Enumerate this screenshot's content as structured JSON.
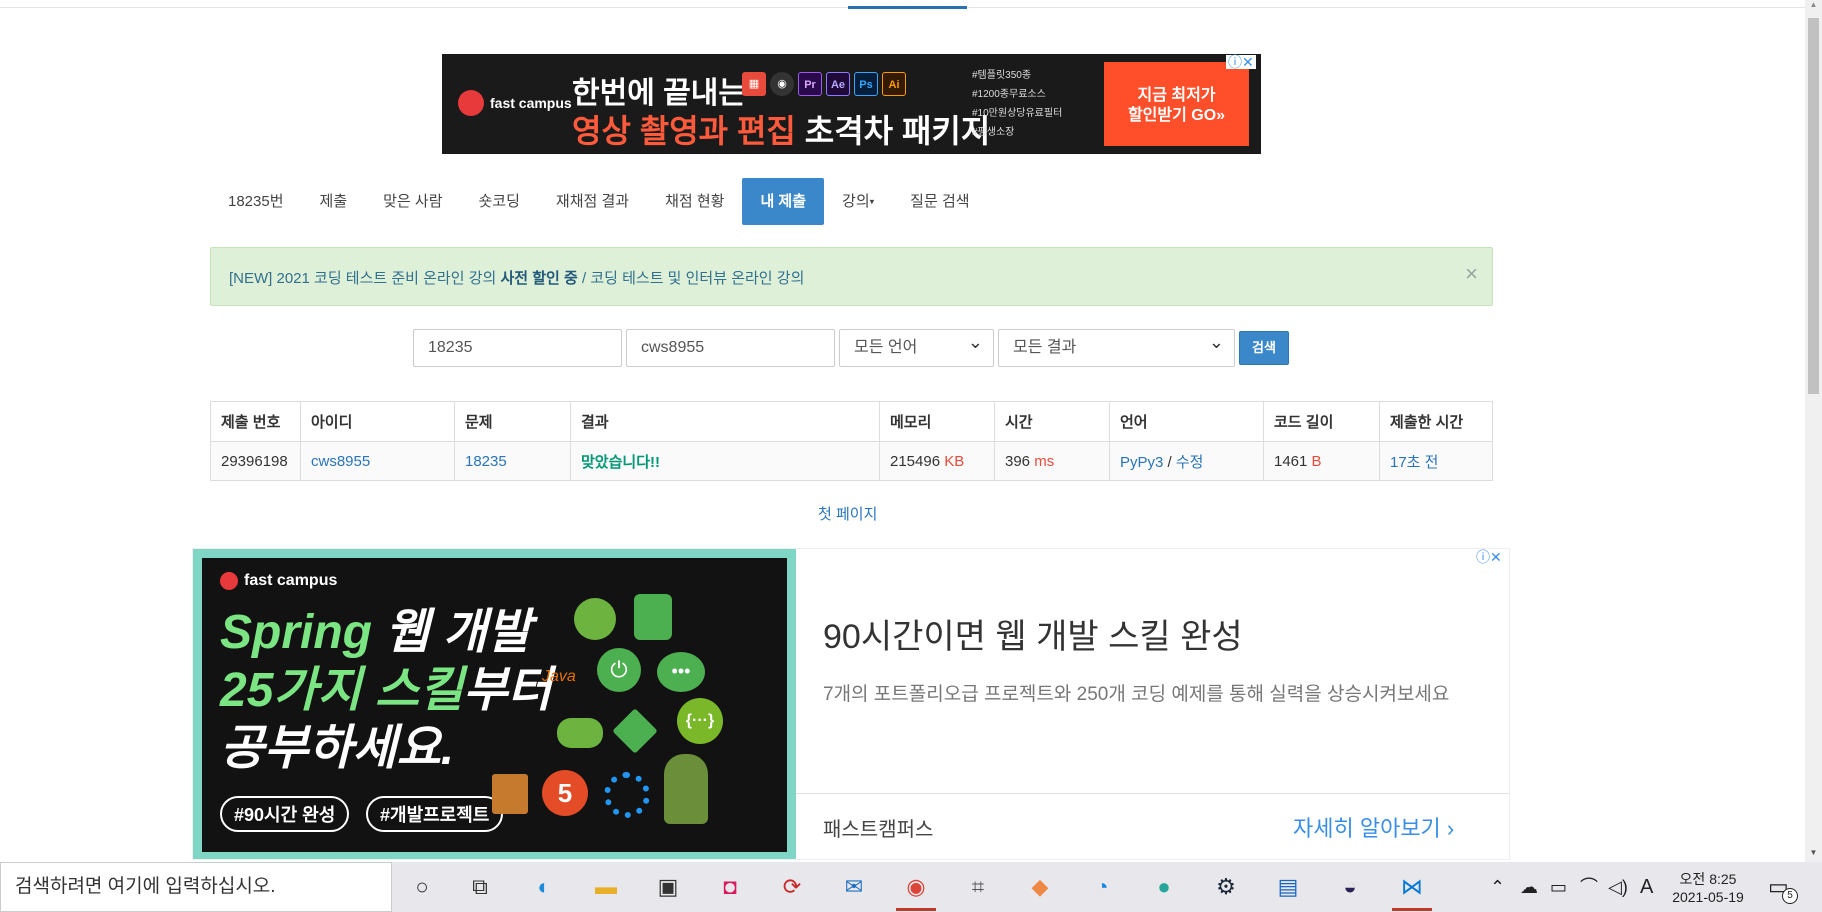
{
  "banner_ad": {
    "logo": "fast campus",
    "line1": "한번에 끝내는",
    "line2_highlight": "영상 촬영과 편집",
    "line2_rest": " 초격차 패키지",
    "apps": [
      "Pr",
      "Ae",
      "Ps",
      "Ai"
    ],
    "tags": [
      "#템플릿350종",
      "#1200종무료소스",
      "#10만원상당유료필터",
      "#평생소장"
    ],
    "cta_line1": "지금 최저가",
    "cta_line2": "할인받기 GO»",
    "adchoice": "ⓘ✕"
  },
  "nav": {
    "tabs": [
      {
        "label": "18235번"
      },
      {
        "label": "제출"
      },
      {
        "label": "맞은 사람"
      },
      {
        "label": "숏코딩"
      },
      {
        "label": "재채점 결과"
      },
      {
        "label": "채점 현황"
      },
      {
        "label": "내 제출"
      },
      {
        "label": "강의"
      },
      {
        "label": "질문 검색"
      }
    ],
    "caret": "▾"
  },
  "alert": {
    "prefix": "[NEW] 2021 코딩 테스트 준비 온라인 강의 ",
    "bold": "사전 할인 중",
    "suffix": " / 코딩 테스트 및 인터뷰 온라인 강의",
    "close": "×"
  },
  "search": {
    "problem_id": "18235",
    "user_id": "cws8955",
    "language": "모든 언어",
    "result": "모든 결과",
    "button": "검색"
  },
  "table": {
    "headers": [
      "제출 번호",
      "아이디",
      "문제",
      "결과",
      "메모리",
      "시간",
      "언어",
      "코드 길이",
      "제출한 시간"
    ],
    "row": {
      "submission_id": "29396198",
      "user": "cws8955",
      "problem": "18235",
      "result": "맞았습니다!!",
      "memory": "215496",
      "memory_unit": "KB",
      "time": "396",
      "time_unit": "ms",
      "language": "PyPy3",
      "lang_sep": " / ",
      "edit": "수정",
      "code_length": "1461",
      "code_unit": "B",
      "submitted": "17초 전"
    }
  },
  "pagination": {
    "first_page": "첫 페이지"
  },
  "lower_ad": {
    "logo": "fast campus",
    "big1_green": "Spring",
    "big1_rest": " 웹 개발",
    "big2_green": "25가지 스킬",
    "big2_rest": "부터",
    "big3": "공부하세요.",
    "pill1": "#90시간 완성",
    "pill2": "#개발프로젝트",
    "java": "Java",
    "headline": "90시간이면 웹 개발 스킬 완성",
    "description": "7개의 포트폴리오급 프로젝트와 250개 코딩 예제를 통해 실력을 상승시켜보세요",
    "brand": "패스트캠퍼스",
    "more": "자세히 알아보기 ›",
    "adchoice": "ⓘ✕"
  },
  "taskbar": {
    "search_placeholder": "검색하려면 여기에 입력하십시오.",
    "icons": [
      "cortana-icon",
      "task-view-icon",
      "edge-icon",
      "file-explorer-icon",
      "store-icon",
      "app-icon",
      "sync-icon",
      "mail-icon",
      "chrome-icon",
      "snip-icon",
      "git-icon",
      "clock-app-icon",
      "app-circle-icon",
      "steam-icon",
      "book-icon",
      "eclipse-icon",
      "vscode-icon"
    ],
    "tray_ime": "A",
    "time": "오전 8:25",
    "date": "2021-05-19",
    "notification_count": "5"
  }
}
